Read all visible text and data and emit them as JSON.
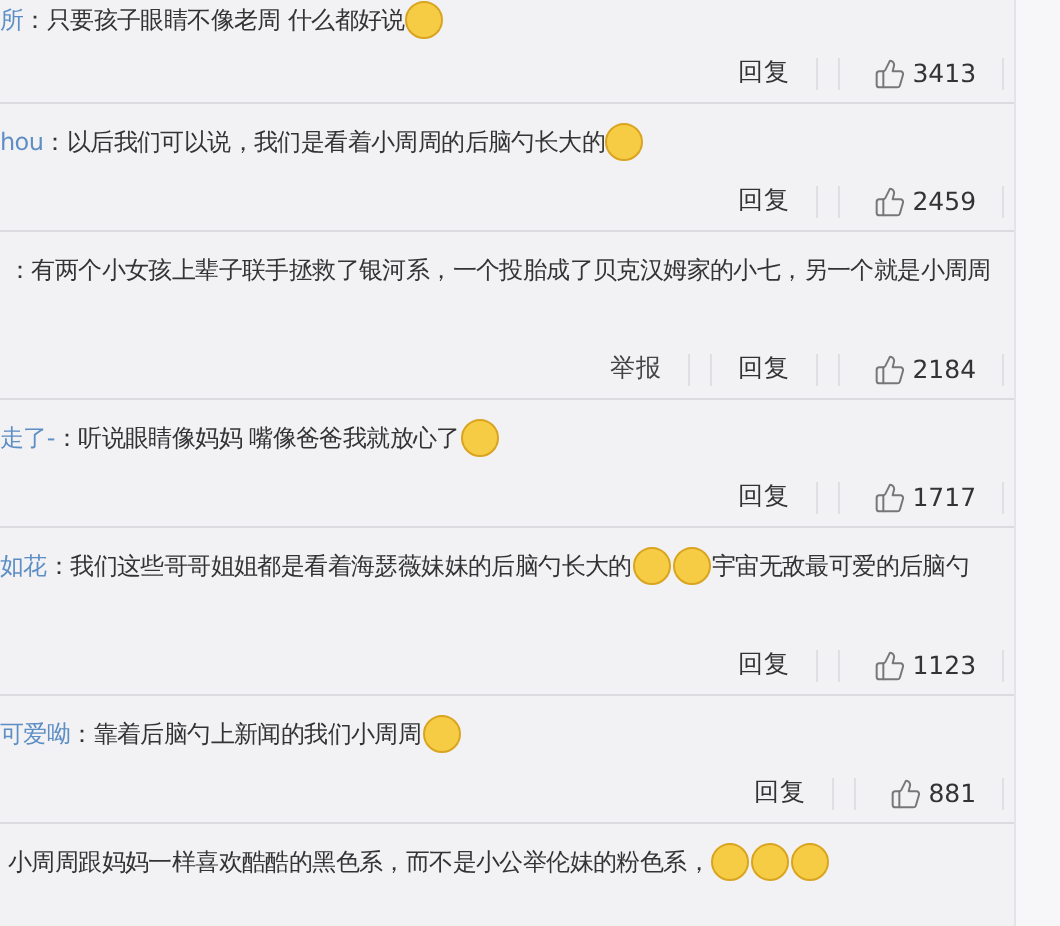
{
  "comments": [
    {
      "user": "所",
      "parts": [
        {
          "kind": "text",
          "text": "：只要孩子眼睛不像老周 什么都好说"
        },
        {
          "kind": "emoji"
        }
      ],
      "actions": [
        {
          "kind": "reply",
          "label": "回复"
        }
      ],
      "likes": "3413"
    },
    {
      "user": "hou",
      "parts": [
        {
          "kind": "text",
          "text": "：以后我们可以说，我们是看着小周周的后脑勺长大的"
        },
        {
          "kind": "emoji"
        }
      ],
      "actions": [
        {
          "kind": "reply",
          "label": "回复"
        }
      ],
      "likes": "2459"
    },
    {
      "parts": [
        {
          "kind": "text",
          "text": "：有两个小女孩上辈子联手拯救了银河系，一个投胎成了贝克汉姆家的小七，另一个就是小周周"
        }
      ],
      "actions": [
        {
          "kind": "report",
          "label": "举报"
        },
        {
          "kind": "reply",
          "label": "回复"
        }
      ],
      "likes": "2184"
    },
    {
      "user": "走了-",
      "parts": [
        {
          "kind": "text",
          "text": "：听说眼睛像妈妈 嘴像爸爸我就放心了"
        },
        {
          "kind": "emoji"
        }
      ],
      "actions": [
        {
          "kind": "reply",
          "label": "回复"
        }
      ],
      "likes": "1717"
    },
    {
      "user": "如花",
      "parts": [
        {
          "kind": "text",
          "text": "：我们这些哥哥姐姐都是看着海瑟薇妹妹的后脑勺长大的"
        },
        {
          "kind": "emoji"
        },
        {
          "kind": "emoji"
        },
        {
          "kind": "text",
          "text": "宇宙无敌最可爱的后脑勺"
        }
      ],
      "actions": [
        {
          "kind": "reply",
          "label": "回复"
        }
      ],
      "likes": "1123"
    },
    {
      "user": "可爱呦",
      "parts": [
        {
          "kind": "text",
          "text": "：靠着后脑勺上新闻的我们小周周"
        },
        {
          "kind": "emoji"
        }
      ],
      "actions": [
        {
          "kind": "reply",
          "label": "回复"
        }
      ],
      "likes": "881"
    },
    {
      "parts": [
        {
          "kind": "text",
          "text": "小周周跟妈妈一样喜欢酷酷的黑色系，而不是小公举伦妹的粉色系，"
        },
        {
          "kind": "emoji"
        },
        {
          "kind": "emoji"
        },
        {
          "kind": "emoji"
        }
      ]
    }
  ]
}
